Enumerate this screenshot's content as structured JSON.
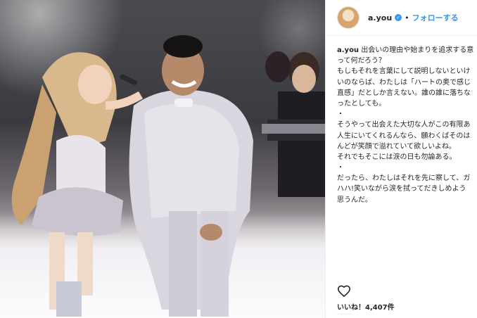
{
  "post": {
    "username": "a.you",
    "follow_label": "フォローする",
    "separator": "•",
    "caption_user": "a.you",
    "caption_lines": [
      "出会いの理由や始まりを追求する意",
      "って何だろう？",
      "もしもそれを言葉にして説明しないといけ",
      "いのならば、わたしは「ハートの奥で感じ",
      "直感」だとしか言えない。誰の誰に落ちな",
      "ったとしても。",
      "・",
      "そうやって出会えた大切な人がこの有限あ",
      "人生にいてくれるんなら、願わくばそのは",
      "んどが笑顔で溢れていて欲しいよね。",
      "それでもそこには涙の日も勿論ある。",
      "・",
      "だったら、わたしはそれを先に察して、ガ",
      "ハハ!笑いながら涙を拭ってだきしめよう",
      "思うんだ。"
    ],
    "likes_text": "いいね！4,407件"
  },
  "icons": {
    "verified": "verified-badge-icon",
    "like": "heart-icon"
  },
  "colors": {
    "link_blue": "#3897f0",
    "text": "#262626",
    "divider": "#efefef"
  }
}
